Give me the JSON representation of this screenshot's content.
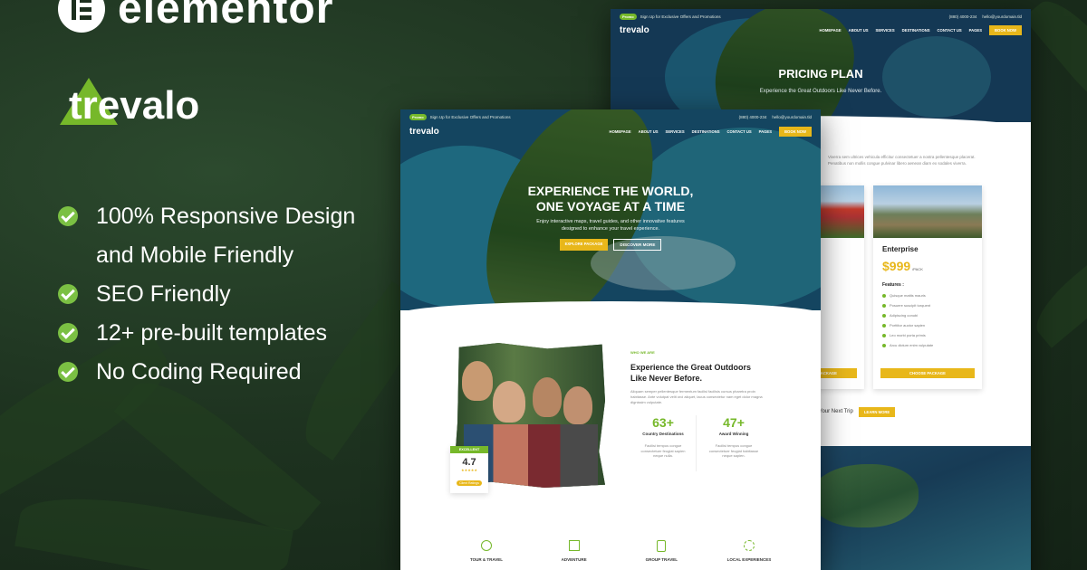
{
  "brand": {
    "builder": "elementor",
    "product": "trevalo"
  },
  "features": [
    "100% Responsive Design",
    "and Mobile Friendly",
    "SEO Friendly",
    "12+ pre-built templates",
    "No Coding Required"
  ],
  "topbar": {
    "promo_badge": "Promo",
    "promo_text": "Sign Up for Exclusive Offers and Promotions",
    "phone": "(880) 4000-234",
    "email": "hello@yourdomain.tld"
  },
  "nav": {
    "logo": "trevalo",
    "items": [
      "Homepage",
      "About Us",
      "Services",
      "Destinations",
      "Contact Us",
      "Pages"
    ],
    "cta": "Book Now"
  },
  "pricing_page": {
    "title": "PRICING PLAN",
    "subtitle": "Experience the Great Outdoors Like Never Before.",
    "intro": "Viverra sem ultrices vehicula efficitur consectetuer a nostra pellentesque placerat. Penatibus non mollis congue pulvinar libero aenean diam ex sodales viverra.",
    "plan": {
      "name": "Enterprise",
      "price": "$999",
      "per": "/PACK",
      "features_label": "Features :",
      "features": [
        "Quisque mattis mauris",
        "Posuere suscipit torquent",
        "Adipiscing conubi",
        "Porttitor auctor sapien",
        "Leo morbi porta primis",
        "Arcu dictum enim vulputate"
      ],
      "cta": "Choose Package",
      "left_cta": "Choose Package"
    },
    "next_trip": "Your Next Trip",
    "next_trip_cta": "Learn More"
  },
  "home": {
    "hero_line1": "EXPERIENCE THE WORLD,",
    "hero_line2": "ONE VOYAGE AT A TIME",
    "hero_sub1": "Enjoy interactive maps, travel guides, and other innovative features",
    "hero_sub2": "designed to enhance your travel experience.",
    "btn_primary": "Explore Package",
    "btn_secondary": "Discover More",
    "who_label": "WHO WE ARE",
    "about_title_1": "Experience the Great Outdoors",
    "about_title_2": "Like Never Before.",
    "about_text": "Aliquam semper pellentesque fermentum facilisi facilisis cursus pharetra proin habitasse. Ante volutpat velit orci aliquet, lacus consectetur nam eget dolor magna dignissim vulputate.",
    "stats": [
      {
        "value": "63+",
        "label": "Country Destinations",
        "text": "Facilisi tempus congue consectetuer feugiat sapien neque nulla."
      },
      {
        "value": "47+",
        "label": "Award Winning",
        "text": "Facilisi tempus congue consectetuer feugiat habitasse neque sapien."
      }
    ],
    "rating": {
      "label": "EXCELLENT",
      "value": "4.7",
      "stars": "★★★★★",
      "caption": "Client Ratings"
    },
    "services": [
      "Tour & Travel",
      "Adventure",
      "Group Travel",
      "Local Experiences"
    ]
  },
  "colors": {
    "accent_green": "#76b82a",
    "accent_yellow": "#e8b71a",
    "dark_green": "#1c2e1e"
  }
}
